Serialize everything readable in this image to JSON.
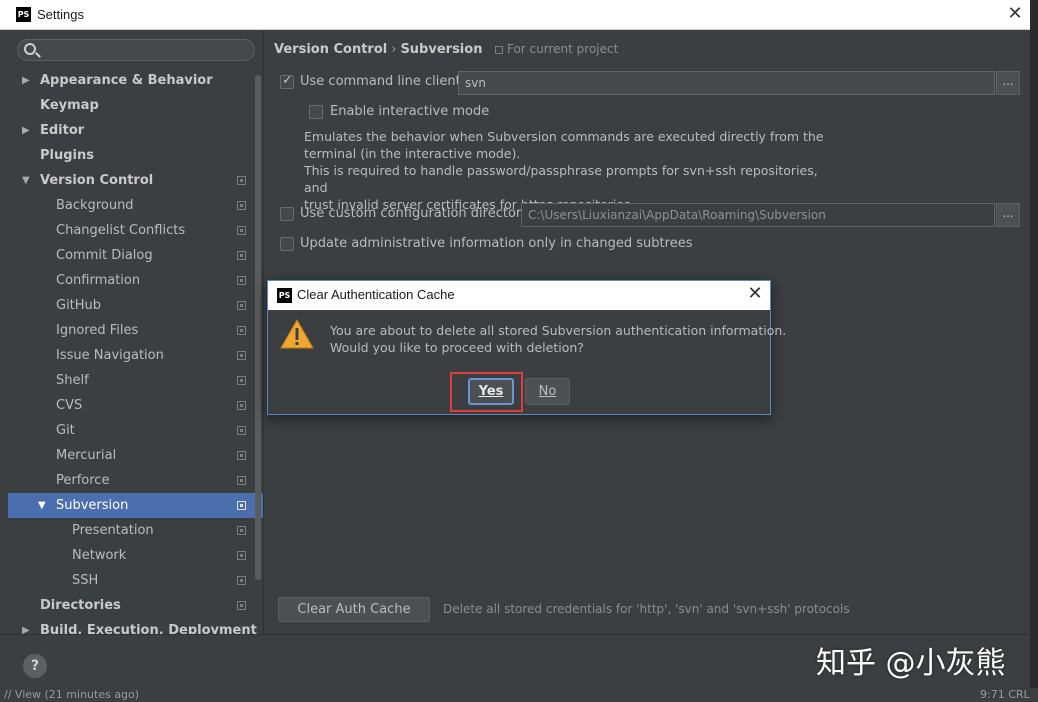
{
  "window": {
    "title": "Settings",
    "logo": "PS"
  },
  "sidebar": {
    "search_placeholder": "",
    "items": [
      {
        "label": "Appearance & Behavior",
        "bold": true,
        "arrow": "▶",
        "level": 0
      },
      {
        "label": "Keymap",
        "bold": true,
        "level": 0
      },
      {
        "label": "Editor",
        "bold": true,
        "arrow": "▶",
        "level": 0
      },
      {
        "label": "Plugins",
        "bold": true,
        "level": 0
      },
      {
        "label": "Version Control",
        "bold": true,
        "arrow": "▼",
        "level": 0,
        "project": true
      },
      {
        "label": "Background",
        "level": 1,
        "project": true
      },
      {
        "label": "Changelist Conflicts",
        "level": 1,
        "project": true
      },
      {
        "label": "Commit Dialog",
        "level": 1,
        "project": true
      },
      {
        "label": "Confirmation",
        "level": 1,
        "project": true
      },
      {
        "label": "GitHub",
        "level": 1,
        "project": true
      },
      {
        "label": "Ignored Files",
        "level": 1,
        "project": true
      },
      {
        "label": "Issue Navigation",
        "level": 1,
        "project": true
      },
      {
        "label": "Shelf",
        "level": 1,
        "project": true
      },
      {
        "label": "CVS",
        "level": 1,
        "project": true
      },
      {
        "label": "Git",
        "level": 1,
        "project": true
      },
      {
        "label": "Mercurial",
        "level": 1,
        "project": true
      },
      {
        "label": "Perforce",
        "level": 1,
        "project": true
      },
      {
        "label": "Subversion",
        "level": 1,
        "arrow": "▼",
        "selected": true,
        "project": true
      },
      {
        "label": "Presentation",
        "level": 2,
        "project": true
      },
      {
        "label": "Network",
        "level": 2,
        "project": true
      },
      {
        "label": "SSH",
        "level": 2,
        "project": true
      },
      {
        "label": "Directories",
        "bold": true,
        "level": 0,
        "project": true
      },
      {
        "label": "Build, Execution, Deployment",
        "bold": true,
        "arrow": "▶",
        "level": 0
      }
    ]
  },
  "content": {
    "breadcrumb": {
      "parent": "Version Control",
      "sep": "›",
      "current": "Subversion",
      "scope": "For current project"
    },
    "use_cmd_client": {
      "label": "Use command line client:",
      "checked": true,
      "value": "svn"
    },
    "interactive_mode": {
      "label": "Enable interactive mode",
      "checked": false
    },
    "description": [
      "Emulates the behavior when Subversion commands are executed directly from the",
      "terminal (in the interactive mode).",
      "This is required to handle password/passphrase prompts for svn+ssh repositories, and",
      "trust invalid server certificates for https repositories."
    ],
    "custom_config": {
      "label": "Use custom configuration directory:",
      "checked": false,
      "value": "C:\\Users\\Liuxianzai\\AppData\\Roaming\\Subversion"
    },
    "update_admin": {
      "label": "Update administrative information only in changed subtrees",
      "checked": false
    },
    "ellipsis": "...",
    "clear_auth_button": "Clear Auth Cache",
    "clear_auth_hint": "Delete all stored credentials for 'http', 'svn' and 'svn+ssh' protocols"
  },
  "bottom": {
    "help": "?",
    "status_left": "// View (21 minutes ago)",
    "status_right": "9:71   CRL",
    "watermark": "知乎 @小灰熊"
  },
  "dialog": {
    "title": "Clear Authentication Cache",
    "message_line1": "You are about to delete all stored Subversion authentication information.",
    "message_line2": "Would you like to proceed with deletion?",
    "yes": "Yes",
    "no": "No"
  },
  "colors": {
    "selection": "#4b6eaf",
    "highlight": "#e23b3b",
    "dialog_border": "#5786c4"
  }
}
